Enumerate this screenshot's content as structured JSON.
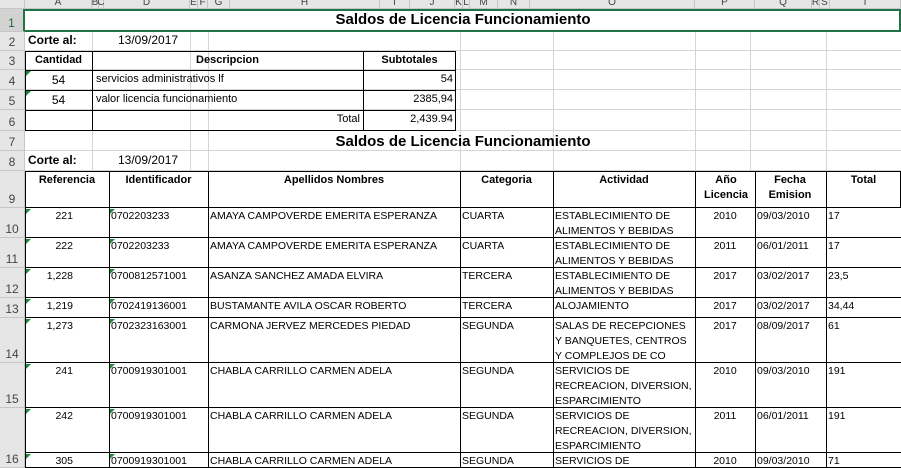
{
  "columns": [
    "A",
    "B",
    "C",
    "D",
    "E",
    "F",
    "G",
    "H",
    "I",
    "J",
    "K",
    "L",
    "M",
    "N",
    "O",
    "P",
    "Q",
    "R",
    "S",
    "T"
  ],
  "row_numbers": [
    "1",
    "2",
    "3",
    "4",
    "5",
    "6",
    "7",
    "8",
    "9",
    "10",
    "11",
    "12",
    "13",
    "14",
    "15",
    "16"
  ],
  "title1": "Saldos de Licencia Funcionamiento",
  "title2": "Saldos de Licencia Funcionamiento",
  "corte_label": "Corte al:",
  "corte_date": "13/09/2017",
  "corte_label2": "Corte al:",
  "corte_date2": "13/09/2017",
  "summary": {
    "headers": [
      "Cantidad",
      "Descripcion",
      "Subtotales"
    ],
    "rows": [
      {
        "cantidad": "54",
        "descripcion": "servicios administrativos lf",
        "subtotal": "54"
      },
      {
        "cantidad": "54",
        "descripcion": "valor licencia funcionamiento",
        "subtotal": "2385,94"
      }
    ],
    "total_label": "Total",
    "total_value": "2,439.94"
  },
  "detail": {
    "headers": {
      "referencia": "Referencia",
      "identificador": "Identificador",
      "nombres": "Apellidos Nombres",
      "categoria": "Categoria",
      "actividad": "Actividad",
      "anio": "Año Licencia",
      "fecha": "Fecha Emision",
      "total": "Total"
    },
    "rows": [
      {
        "ref": "221",
        "id": "0702203233",
        "nombre": "AMAYA CAMPOVERDE EMERITA ESPERANZA",
        "cat": "CUARTA",
        "act": "ESTABLECIMIENTO DE ALIMENTOS Y BEBIDAS",
        "anio": "2010",
        "fecha": "09/03/2010",
        "total": "17"
      },
      {
        "ref": "222",
        "id": "0702203233",
        "nombre": "AMAYA CAMPOVERDE EMERITA ESPERANZA",
        "cat": "CUARTA",
        "act": "ESTABLECIMIENTO DE ALIMENTOS Y BEBIDAS",
        "anio": "2011",
        "fecha": "06/01/2011",
        "total": "17"
      },
      {
        "ref": "1,228",
        "id": "0700812571001",
        "nombre": "ASANZA SANCHEZ AMADA ELVIRA",
        "cat": "TERCERA",
        "act": "ESTABLECIMIENTO DE ALIMENTOS Y BEBIDAS",
        "anio": "2017",
        "fecha": "03/02/2017",
        "total": "23,5"
      },
      {
        "ref": "1,219",
        "id": "0702419136001",
        "nombre": "BUSTAMANTE AVILA OSCAR ROBERTO",
        "cat": "TERCERA",
        "act": "ALOJAMIENTO",
        "anio": "2017",
        "fecha": "03/02/2017",
        "total": "34,44"
      },
      {
        "ref": "1,273",
        "id": "0702323163001",
        "nombre": "CARMONA JERVEZ MERCEDES PIEDAD",
        "cat": "SEGUNDA",
        "act": "SALAS DE RECEPCIONES Y BANQUETES, CENTROS Y COMPLEJOS DE CO",
        "anio": "2017",
        "fecha": "08/09/2017",
        "total": "61"
      },
      {
        "ref": "241",
        "id": "0700919301001",
        "nombre": "CHABLA CARRILLO  CARMEN ADELA",
        "cat": "SEGUNDA",
        "act": "SERVICIOS DE RECREACION, DIVERSION, ESPARCIMIENTO",
        "anio": "2010",
        "fecha": "09/03/2010",
        "total": "191"
      },
      {
        "ref": "242",
        "id": "0700919301001",
        "nombre": "CHABLA CARRILLO  CARMEN ADELA",
        "cat": "SEGUNDA",
        "act": "SERVICIOS DE RECREACION, DIVERSION, ESPARCIMIENTO",
        "anio": "2011",
        "fecha": "06/01/2011",
        "total": "191"
      },
      {
        "ref": "305",
        "id": "0700919301001",
        "nombre": "CHABLA CARRILLO  CARMEN ADELA",
        "cat": "SEGUNDA",
        "act": "SERVICIOS DE",
        "anio": "2010",
        "fecha": "09/03/2010",
        "total": "71"
      }
    ]
  }
}
